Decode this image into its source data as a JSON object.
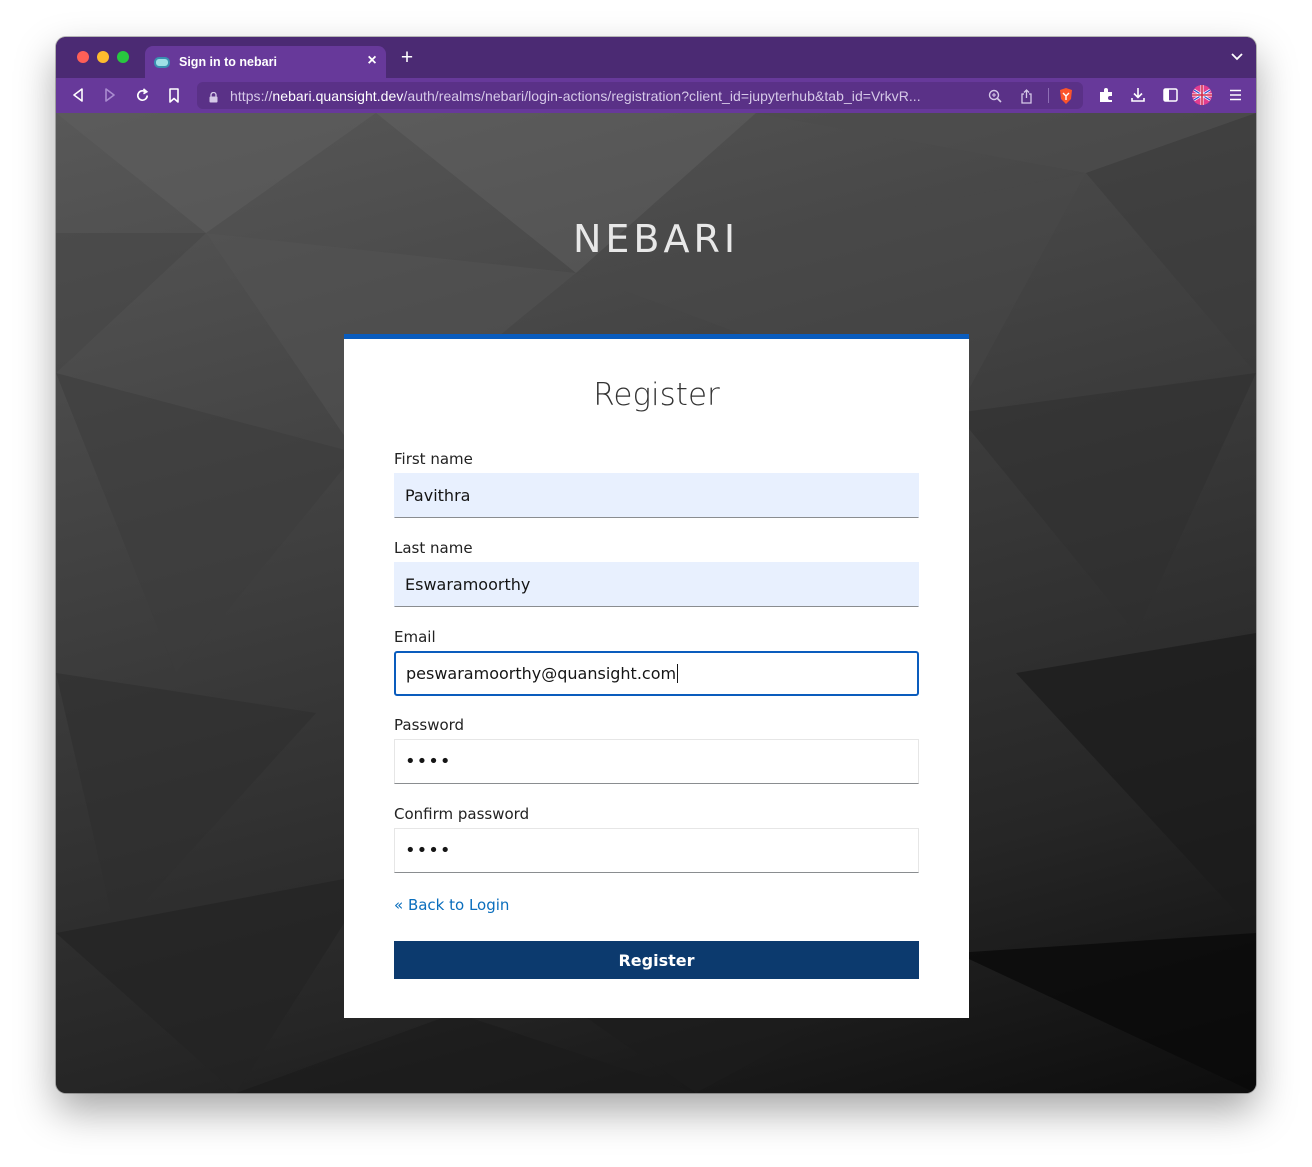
{
  "browser": {
    "tab_title": "Sign in to nebari",
    "url_scheme": "https://",
    "url_host": "nebari.quansight.dev",
    "url_path": "/auth/realms/nebari/login-actions/registration?client_id=jupyterhub&tab_id=VrkvR...",
    "theme_color": "#67399a"
  },
  "page": {
    "brand": "NEBARI",
    "form_title": "Register",
    "fields": {
      "first_name": {
        "label": "First name",
        "value": "Pavithra"
      },
      "last_name": {
        "label": "Last name",
        "value": "Eswaramoorthy"
      },
      "email": {
        "label": "Email",
        "value": "peswaramoorthy@quansight.com"
      },
      "password": {
        "label": "Password",
        "value": "••••"
      },
      "confirm_password": {
        "label": "Confirm password",
        "value": "••••"
      }
    },
    "back_link": "« Back to Login",
    "submit_label": "Register",
    "accent_color": "#0a5cbd",
    "button_color": "#0c3a6e"
  }
}
